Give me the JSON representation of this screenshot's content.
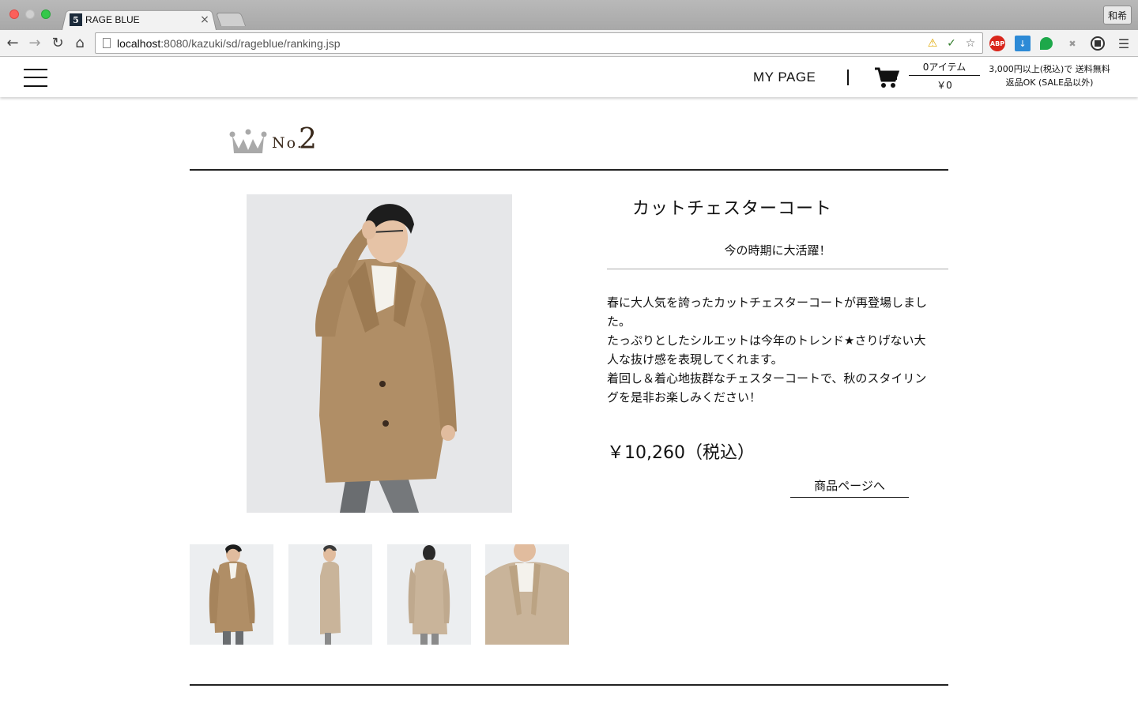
{
  "browser": {
    "tab_title": "RAGE BLUE",
    "tab_close": "×",
    "favicon_text": "5",
    "profile_label": "和希",
    "url_host": "localhost",
    "url_path": ":8080/kazuki/sd/rageblue/ranking.jsp",
    "extensions": [
      "abp-icon",
      "download-icon",
      "chat-icon",
      "blocked-icon",
      "record-icon",
      "menu-icon"
    ],
    "abp_label": "ABP"
  },
  "header": {
    "mypage_label": "MY PAGE",
    "cart_items": "0アイテム",
    "cart_total": "￥0",
    "shipping_line1": "3,000円以上(税込)で 送料無料",
    "shipping_line2": "返品OK (SALE品以外)"
  },
  "ranking": {
    "no_label": "No.",
    "number": "2"
  },
  "product": {
    "title": "カットチェスターコート",
    "catchcopy": "今の時期に大活躍！",
    "description": [
      "春に大人気を誇ったカットチェスターコートが再登場しまし",
      "た。",
      "たっぷりとしたシルエットは今年のトレンド★さりげない大",
      "人な抜け感を表現してくれます。",
      "着回し＆着心地抜群なチェスターコートで、秋のスタイリン",
      "グを是非お楽しみください！"
    ],
    "price": "￥10,260（税込）",
    "detail_link": "商品ページへ"
  },
  "colors": {
    "coat": "#b08e66",
    "coat_light": "#c9b49a",
    "accent_brown": "#3a2a1c"
  }
}
